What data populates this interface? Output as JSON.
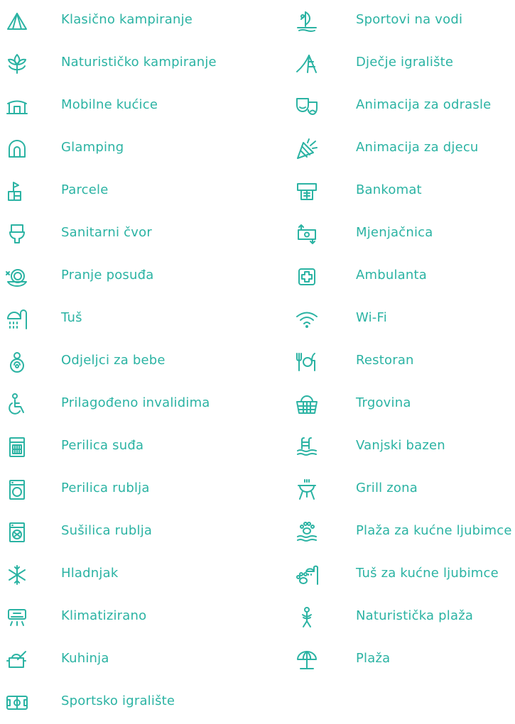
{
  "accent_color": "#2bb3a3",
  "left_items": [
    {
      "label": "Klasično kampiranje",
      "icon": "tent-icon"
    },
    {
      "label": "Naturističko kampiranje",
      "icon": "leaf-icon"
    },
    {
      "label": "Mobilne kućice",
      "icon": "mobile-home-icon"
    },
    {
      "label": "Glamping",
      "icon": "glamping-icon"
    },
    {
      "label": "Parcele",
      "icon": "parcel-flag-icon"
    },
    {
      "label": "Sanitarni čvor",
      "icon": "toilet-icon"
    },
    {
      "label": "Pranje posuđa",
      "icon": "dishwashing-icon"
    },
    {
      "label": "Tuš",
      "icon": "shower-icon"
    },
    {
      "label": "Odjeljci za bebe",
      "icon": "baby-icon"
    },
    {
      "label": "Prilagođeno invalidima",
      "icon": "wheelchair-icon"
    },
    {
      "label": "Perilica suđa",
      "icon": "dishwasher-icon"
    },
    {
      "label": "Perilica rublja",
      "icon": "washing-machine-icon"
    },
    {
      "label": "Sušilica rublja",
      "icon": "dryer-icon"
    },
    {
      "label": "Hladnjak",
      "icon": "snowflake-icon"
    },
    {
      "label": "Klimatizirano",
      "icon": "air-conditioner-icon"
    },
    {
      "label": "Kuhinja",
      "icon": "kitchen-icon"
    },
    {
      "label": "Sportsko igralište",
      "icon": "sports-field-icon"
    }
  ],
  "right_items": [
    {
      "label": "Sportovi na vodi",
      "icon": "windsurf-icon"
    },
    {
      "label": "Dječje igralište",
      "icon": "slide-icon"
    },
    {
      "label": "Animacija za odrasle",
      "icon": "theatre-masks-icon"
    },
    {
      "label": "Animacija za djecu",
      "icon": "party-popper-icon"
    },
    {
      "label": "Bankomat",
      "icon": "atm-icon"
    },
    {
      "label": "Mjenjačnica",
      "icon": "exchange-icon"
    },
    {
      "label": "Ambulanta",
      "icon": "first-aid-icon"
    },
    {
      "label": "Wi-Fi",
      "icon": "wifi-icon"
    },
    {
      "label": "Restoran",
      "icon": "restaurant-icon"
    },
    {
      "label": "Trgovina",
      "icon": "shopping-basket-icon"
    },
    {
      "label": "Vanjski bazen",
      "icon": "pool-icon"
    },
    {
      "label": "Grill  zona",
      "icon": "grill-icon"
    },
    {
      "label": "Plaža za kućne ljubimce",
      "icon": "pet-beach-icon"
    },
    {
      "label": "Tuš za kućne ljubimce",
      "icon": "pet-shower-icon"
    },
    {
      "label": "Naturistička plaža",
      "icon": "naturist-beach-icon"
    },
    {
      "label": "Plaža",
      "icon": "beach-umbrella-icon"
    }
  ]
}
